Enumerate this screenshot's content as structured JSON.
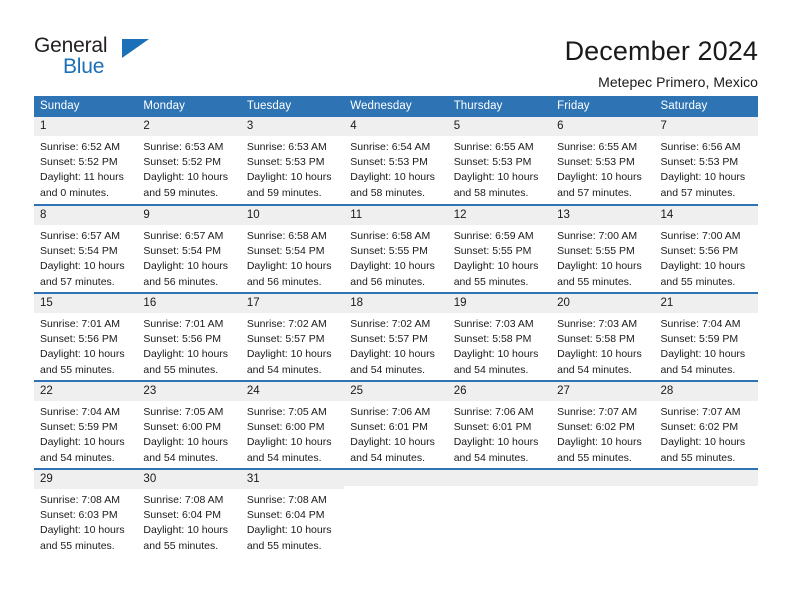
{
  "brand": {
    "name_part1": "General",
    "name_part2": "Blue",
    "icon": "triangle-logo-icon"
  },
  "header": {
    "title": "December 2024",
    "subtitle": "Metepec Primero, Mexico"
  },
  "colors": {
    "header_blue": "#2e74b5",
    "brand_blue": "#1c70b8",
    "daynum_band": "#efefef",
    "text": "#1a1a1a"
  },
  "weekday_headers": [
    "Sunday",
    "Monday",
    "Tuesday",
    "Wednesday",
    "Thursday",
    "Friday",
    "Saturday"
  ],
  "weeks": [
    [
      {
        "day": "1",
        "sunrise": "Sunrise: 6:52 AM",
        "sunset": "Sunset: 5:52 PM",
        "daylight": "Daylight: 11 hours and 0 minutes."
      },
      {
        "day": "2",
        "sunrise": "Sunrise: 6:53 AM",
        "sunset": "Sunset: 5:52 PM",
        "daylight": "Daylight: 10 hours and 59 minutes."
      },
      {
        "day": "3",
        "sunrise": "Sunrise: 6:53 AM",
        "sunset": "Sunset: 5:53 PM",
        "daylight": "Daylight: 10 hours and 59 minutes."
      },
      {
        "day": "4",
        "sunrise": "Sunrise: 6:54 AM",
        "sunset": "Sunset: 5:53 PM",
        "daylight": "Daylight: 10 hours and 58 minutes."
      },
      {
        "day": "5",
        "sunrise": "Sunrise: 6:55 AM",
        "sunset": "Sunset: 5:53 PM",
        "daylight": "Daylight: 10 hours and 58 minutes."
      },
      {
        "day": "6",
        "sunrise": "Sunrise: 6:55 AM",
        "sunset": "Sunset: 5:53 PM",
        "daylight": "Daylight: 10 hours and 57 minutes."
      },
      {
        "day": "7",
        "sunrise": "Sunrise: 6:56 AM",
        "sunset": "Sunset: 5:53 PM",
        "daylight": "Daylight: 10 hours and 57 minutes."
      }
    ],
    [
      {
        "day": "8",
        "sunrise": "Sunrise: 6:57 AM",
        "sunset": "Sunset: 5:54 PM",
        "daylight": "Daylight: 10 hours and 57 minutes."
      },
      {
        "day": "9",
        "sunrise": "Sunrise: 6:57 AM",
        "sunset": "Sunset: 5:54 PM",
        "daylight": "Daylight: 10 hours and 56 minutes."
      },
      {
        "day": "10",
        "sunrise": "Sunrise: 6:58 AM",
        "sunset": "Sunset: 5:54 PM",
        "daylight": "Daylight: 10 hours and 56 minutes."
      },
      {
        "day": "11",
        "sunrise": "Sunrise: 6:58 AM",
        "sunset": "Sunset: 5:55 PM",
        "daylight": "Daylight: 10 hours and 56 minutes."
      },
      {
        "day": "12",
        "sunrise": "Sunrise: 6:59 AM",
        "sunset": "Sunset: 5:55 PM",
        "daylight": "Daylight: 10 hours and 55 minutes."
      },
      {
        "day": "13",
        "sunrise": "Sunrise: 7:00 AM",
        "sunset": "Sunset: 5:55 PM",
        "daylight": "Daylight: 10 hours and 55 minutes."
      },
      {
        "day": "14",
        "sunrise": "Sunrise: 7:00 AM",
        "sunset": "Sunset: 5:56 PM",
        "daylight": "Daylight: 10 hours and 55 minutes."
      }
    ],
    [
      {
        "day": "15",
        "sunrise": "Sunrise: 7:01 AM",
        "sunset": "Sunset: 5:56 PM",
        "daylight": "Daylight: 10 hours and 55 minutes."
      },
      {
        "day": "16",
        "sunrise": "Sunrise: 7:01 AM",
        "sunset": "Sunset: 5:56 PM",
        "daylight": "Daylight: 10 hours and 55 minutes."
      },
      {
        "day": "17",
        "sunrise": "Sunrise: 7:02 AM",
        "sunset": "Sunset: 5:57 PM",
        "daylight": "Daylight: 10 hours and 54 minutes."
      },
      {
        "day": "18",
        "sunrise": "Sunrise: 7:02 AM",
        "sunset": "Sunset: 5:57 PM",
        "daylight": "Daylight: 10 hours and 54 minutes."
      },
      {
        "day": "19",
        "sunrise": "Sunrise: 7:03 AM",
        "sunset": "Sunset: 5:58 PM",
        "daylight": "Daylight: 10 hours and 54 minutes."
      },
      {
        "day": "20",
        "sunrise": "Sunrise: 7:03 AM",
        "sunset": "Sunset: 5:58 PM",
        "daylight": "Daylight: 10 hours and 54 minutes."
      },
      {
        "day": "21",
        "sunrise": "Sunrise: 7:04 AM",
        "sunset": "Sunset: 5:59 PM",
        "daylight": "Daylight: 10 hours and 54 minutes."
      }
    ],
    [
      {
        "day": "22",
        "sunrise": "Sunrise: 7:04 AM",
        "sunset": "Sunset: 5:59 PM",
        "daylight": "Daylight: 10 hours and 54 minutes."
      },
      {
        "day": "23",
        "sunrise": "Sunrise: 7:05 AM",
        "sunset": "Sunset: 6:00 PM",
        "daylight": "Daylight: 10 hours and 54 minutes."
      },
      {
        "day": "24",
        "sunrise": "Sunrise: 7:05 AM",
        "sunset": "Sunset: 6:00 PM",
        "daylight": "Daylight: 10 hours and 54 minutes."
      },
      {
        "day": "25",
        "sunrise": "Sunrise: 7:06 AM",
        "sunset": "Sunset: 6:01 PM",
        "daylight": "Daylight: 10 hours and 54 minutes."
      },
      {
        "day": "26",
        "sunrise": "Sunrise: 7:06 AM",
        "sunset": "Sunset: 6:01 PM",
        "daylight": "Daylight: 10 hours and 54 minutes."
      },
      {
        "day": "27",
        "sunrise": "Sunrise: 7:07 AM",
        "sunset": "Sunset: 6:02 PM",
        "daylight": "Daylight: 10 hours and 55 minutes."
      },
      {
        "day": "28",
        "sunrise": "Sunrise: 7:07 AM",
        "sunset": "Sunset: 6:02 PM",
        "daylight": "Daylight: 10 hours and 55 minutes."
      }
    ],
    [
      {
        "day": "29",
        "sunrise": "Sunrise: 7:08 AM",
        "sunset": "Sunset: 6:03 PM",
        "daylight": "Daylight: 10 hours and 55 minutes."
      },
      {
        "day": "30",
        "sunrise": "Sunrise: 7:08 AM",
        "sunset": "Sunset: 6:04 PM",
        "daylight": "Daylight: 10 hours and 55 minutes."
      },
      {
        "day": "31",
        "sunrise": "Sunrise: 7:08 AM",
        "sunset": "Sunset: 6:04 PM",
        "daylight": "Daylight: 10 hours and 55 minutes."
      },
      {
        "day": "",
        "sunrise": "",
        "sunset": "",
        "daylight": ""
      },
      {
        "day": "",
        "sunrise": "",
        "sunset": "",
        "daylight": ""
      },
      {
        "day": "",
        "sunrise": "",
        "sunset": "",
        "daylight": ""
      },
      {
        "day": "",
        "sunrise": "",
        "sunset": "",
        "daylight": ""
      }
    ]
  ]
}
